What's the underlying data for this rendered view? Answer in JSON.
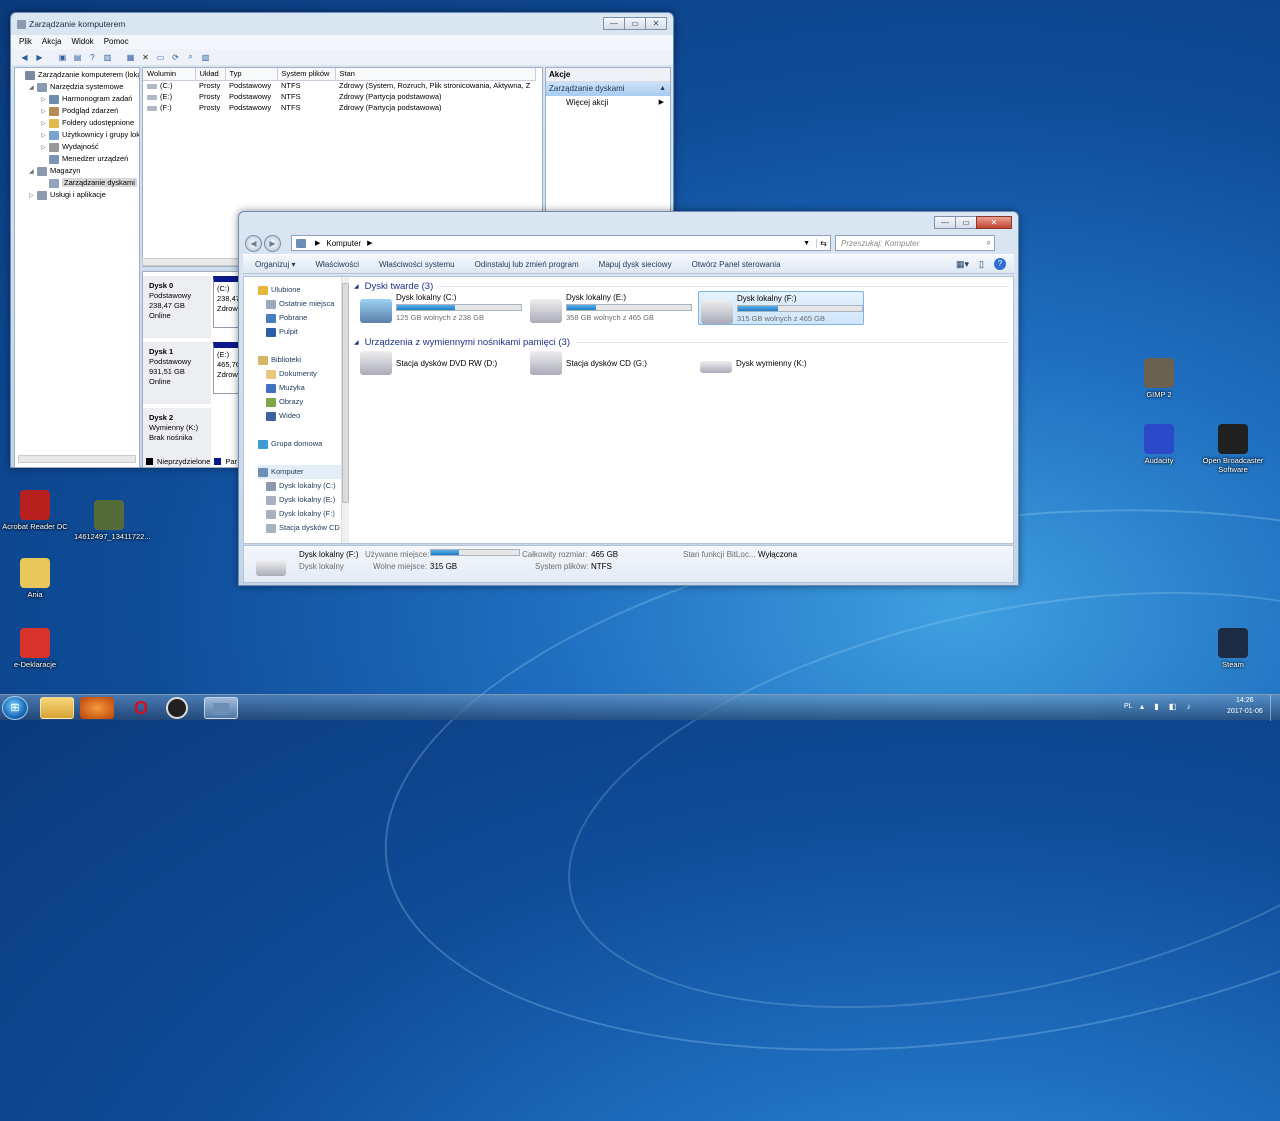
{
  "cm": {
    "title": "Zarządzanie komputerem",
    "menu": [
      "Plik",
      "Akcja",
      "Widok",
      "Pomoc"
    ],
    "tree": [
      {
        "label": "Zarządzanie komputerem (loka",
        "lvl": 0,
        "ex": "",
        "col": "#7c8aa0"
      },
      {
        "label": "Narzędzia systemowe",
        "lvl": 1,
        "ex": "◢",
        "col": "#8a9bb0"
      },
      {
        "label": "Harmonogram zadań",
        "lvl": 2,
        "ex": "▷",
        "col": "#6f8cb1"
      },
      {
        "label": "Podgląd zdarzeń",
        "lvl": 2,
        "ex": "▷",
        "col": "#b48c55"
      },
      {
        "label": "Foldery udostępnione",
        "lvl": 2,
        "ex": "▷",
        "col": "#e0b94f"
      },
      {
        "label": "Użytkownicy i grupy lok",
        "lvl": 2,
        "ex": "▷",
        "col": "#7aa3cf"
      },
      {
        "label": "Wydajność",
        "lvl": 2,
        "ex": "▷",
        "col": "#999"
      },
      {
        "label": "Menedżer urządzeń",
        "lvl": 2,
        "ex": "",
        "col": "#7a93b7"
      },
      {
        "label": "Magazyn",
        "lvl": 1,
        "ex": "◢",
        "col": "#8a9bb0"
      },
      {
        "label": "Zarządzanie dyskami",
        "lvl": 2,
        "ex": "",
        "col": "#93a4bb",
        "sel": true
      },
      {
        "label": "Usługi i aplikacje",
        "lvl": 1,
        "ex": "▷",
        "col": "#8a9bb0"
      }
    ],
    "columns": [
      "Wolumin",
      "Układ",
      "Typ",
      "System plików",
      "Stan"
    ],
    "rows": [
      [
        "(C:)",
        "Prosty",
        "Podstawowy",
        "NTFS",
        "Zdrowy (System, Rozruch, Plik stronicowania, Aktywna, Z"
      ],
      [
        "(E:)",
        "Prosty",
        "Podstawowy",
        "NTFS",
        "Zdrowy (Partycja podstawowa)"
      ],
      [
        "(F:)",
        "Prosty",
        "Podstawowy",
        "NTFS",
        "Zdrowy (Partycja podstawowa)"
      ]
    ],
    "actions": {
      "header": "Akcje",
      "selected": "Zarządzanie dyskami",
      "more": "Więcej akcji"
    },
    "disks": [
      {
        "name": "Dysk 0",
        "type": "Podstawowy",
        "size": "238,47 GB",
        "status": "Online",
        "vol": "(C:)",
        "vsize": "238,47",
        "vstat": "Zdrow"
      },
      {
        "name": "Dysk 1",
        "type": "Podstawowy",
        "size": "931,51 GB",
        "status": "Online",
        "vol": "(E:)",
        "vsize": "465,76",
        "vstat": "Zdrow"
      },
      {
        "name": "Dysk 2",
        "type": "Wymienny (K:)",
        "size": "",
        "status": "Brak nośnika",
        "vol": "",
        "vsize": "",
        "vstat": ""
      }
    ],
    "legend": [
      "Nieprzydzielone",
      "Par"
    ]
  },
  "ex": {
    "path": "Komputer",
    "search_placeholder": "Przeszukaj: Komputer",
    "cmds": [
      "Organizuj ▾",
      "Właściwości",
      "Właściwości systemu",
      "Odinstaluj lub zmień program",
      "Mapuj dysk sieciowy",
      "Otwórz Panel sterowania"
    ],
    "nav": [
      {
        "label": "Ulubione",
        "icon": "star-icon",
        "col": "#e8b73a",
        "hdr": true
      },
      {
        "label": "Ostatnie miejsca",
        "col": "#9aaabe"
      },
      {
        "label": "Pobrane",
        "col": "#4a7dc2"
      },
      {
        "label": "Pulpit",
        "col": "#2d5fa8"
      },
      {
        "label": "",
        "gap": true
      },
      {
        "label": "Biblioteki",
        "col": "#d7b668",
        "hdr": true
      },
      {
        "label": "Dokumenty",
        "col": "#e8c77f"
      },
      {
        "label": "Muzyka",
        "col": "#3f73c0"
      },
      {
        "label": "Obrazy",
        "col": "#7ca648"
      },
      {
        "label": "Wideo",
        "col": "#3f5fa0"
      },
      {
        "label": "",
        "gap": true
      },
      {
        "label": "Grupa domowa",
        "col": "#3d9bd4",
        "hdr": true
      },
      {
        "label": "",
        "gap": true
      },
      {
        "label": "Komputer",
        "col": "#6d8fb5",
        "hdr": true,
        "sel": true
      },
      {
        "label": "Dysk lokalny (C:)",
        "col": "#8a99ac"
      },
      {
        "label": "Dysk lokalny (E:)",
        "col": "#a7b2c0"
      },
      {
        "label": "Dysk lokalny (F:)",
        "col": "#a7b2c0"
      },
      {
        "label": "Stacja dysków CD",
        "col": "#a7b2c0"
      }
    ],
    "group1": "Dyski twarde (3)",
    "group2": "Urządzenia z wymiennymi nośnikami pamięci (3)",
    "hdd": [
      {
        "name": "Dysk lokalny (C:)",
        "free": "125 GB wolnych z 238 GB",
        "used": 0.47
      },
      {
        "name": "Dysk lokalny (E:)",
        "free": "358 GB wolnych z 465 GB",
        "used": 0.23
      },
      {
        "name": "Dysk lokalny (F:)",
        "free": "315 GB wolnych z 465 GB",
        "used": 0.32,
        "sel": true
      }
    ],
    "rem": [
      "Stacja dysków DVD RW (D:)",
      "Stacja dysków CD (G:)",
      "Dysk wymienny (K:)"
    ],
    "details": {
      "name": "Dysk lokalny (F:)",
      "type": "Dysk lokalny",
      "used_lbl": "Używane miejsce:",
      "free_lbl": "Wolne miejsce:",
      "free": "315 GB",
      "total_lbl": "Całkowity rozmiar:",
      "total": "465 GB",
      "fs_lbl": "System plików:",
      "fs": "NTFS",
      "bit_lbl": "Stan funkcji BitLoc...",
      "bit": "Wyłączona",
      "used": 0.32
    }
  },
  "desktop": [
    {
      "label": "Acrobat Reader DC",
      "col": "#b8201e"
    },
    {
      "label": "14612497_13411722...",
      "col": "#556b3a"
    },
    {
      "label": "Ania",
      "col": "#e9c75a"
    },
    {
      "label": "e-Deklaracje",
      "col": "#d8322a"
    },
    {
      "label": "GIMP 2",
      "col": "#6b6150"
    },
    {
      "label": "Audacity",
      "col": "#2b49c9"
    },
    {
      "label": "Open Broadcaster Software",
      "col": "#202020"
    },
    {
      "label": "Steam",
      "col": "#1d2b44"
    }
  ],
  "tray": {
    "lang": "PL",
    "time": "14:26",
    "date": "2017-01-06"
  }
}
